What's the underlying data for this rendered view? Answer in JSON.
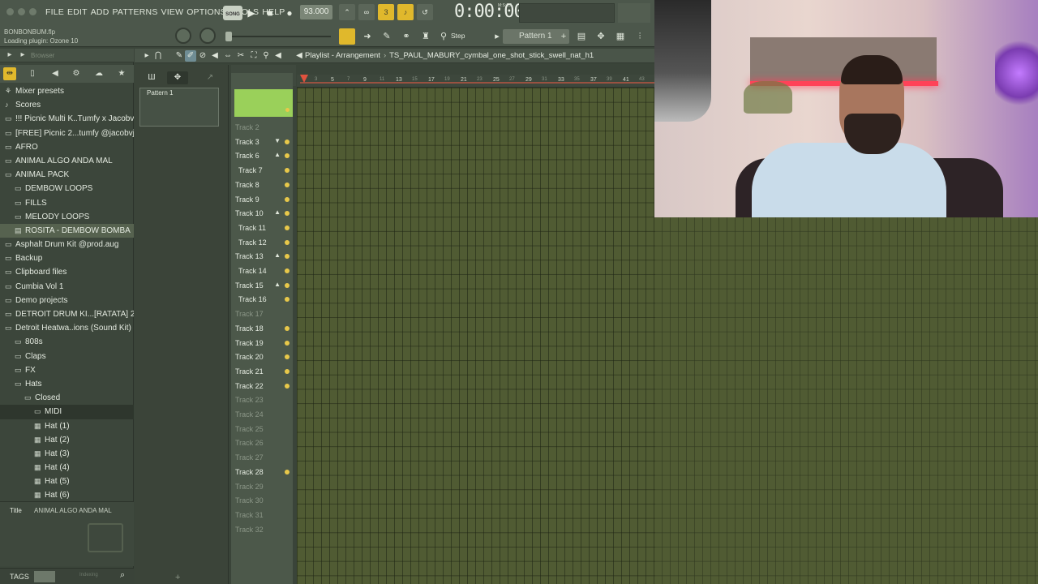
{
  "menu": [
    "FILE",
    "EDIT",
    "ADD",
    "PATTERNS",
    "VIEW",
    "OPTIONS",
    "TOOLS",
    "HELP"
  ],
  "transport": {
    "song_mode": "SONG",
    "tempo": "93.000",
    "time": "0:00:00",
    "time_unit": "M:S:CS"
  },
  "project": {
    "filename": "BONBONBUM.flp",
    "hint": "Loading plugin: Ozone 10"
  },
  "toolbar2": {
    "step_label": "Step",
    "pattern": "Pattern 1"
  },
  "browser": {
    "title": "Browser",
    "items": [
      {
        "label": "Mixer presets",
        "icon": "mixer-icon",
        "indent": 0
      },
      {
        "label": "Scores",
        "icon": "note-icon",
        "indent": 0
      },
      {
        "label": "!!! Picnic Multi K..Tumfy x Jacobvj))",
        "icon": "folder-icon",
        "indent": 0
      },
      {
        "label": "[FREE] Picnic 2...tumfy @jacobvj1)",
        "icon": "folder-icon",
        "indent": 0
      },
      {
        "label": "AFRO",
        "icon": "folder-icon",
        "indent": 0
      },
      {
        "label": "ANIMAL ALGO ANDA MAL",
        "icon": "folder-icon",
        "indent": 0
      },
      {
        "label": "ANIMAL PACK",
        "icon": "folder-icon",
        "indent": 0
      },
      {
        "label": "DEMBOW LOOPS",
        "icon": "folder-icon",
        "indent": 1
      },
      {
        "label": "FILLS",
        "icon": "folder-icon",
        "indent": 1
      },
      {
        "label": "MELODY LOOPS",
        "icon": "folder-icon",
        "indent": 1
      },
      {
        "label": "ROSITA - DEMBOW BOMBA",
        "icon": "file-icon",
        "indent": 1,
        "highlight": true
      },
      {
        "label": "Asphalt Drum Kit @prod.aug",
        "icon": "folder-icon",
        "indent": 0
      },
      {
        "label": "Backup",
        "icon": "backup-icon",
        "indent": 0
      },
      {
        "label": "Clipboard files",
        "icon": "folder-icon",
        "indent": 0
      },
      {
        "label": "Cumbia Vol 1",
        "icon": "folder-icon",
        "indent": 0
      },
      {
        "label": "Demo projects",
        "icon": "folder-icon",
        "indent": 0
      },
      {
        "label": "DETROIT DRUM KI...[RATATA] 2023",
        "icon": "folder-icon",
        "indent": 0
      },
      {
        "label": "Detroit Heatwa..ions (Sound Kit)",
        "icon": "folder-icon",
        "indent": 0
      },
      {
        "label": "808s",
        "icon": "folder-icon",
        "indent": 1
      },
      {
        "label": "Claps",
        "icon": "folder-icon",
        "indent": 1
      },
      {
        "label": "FX",
        "icon": "folder-icon",
        "indent": 1
      },
      {
        "label": "Hats",
        "icon": "folder-icon",
        "indent": 1
      },
      {
        "label": "Closed",
        "icon": "folder-icon",
        "indent": 2
      },
      {
        "label": "MIDI",
        "icon": "folder-icon",
        "indent": 3,
        "selected": true
      },
      {
        "label": "Hat (1)",
        "icon": "midi-file-icon",
        "indent": 3
      },
      {
        "label": "Hat (2)",
        "icon": "midi-file-icon",
        "indent": 3
      },
      {
        "label": "Hat (3)",
        "icon": "midi-file-icon",
        "indent": 3
      },
      {
        "label": "Hat (4)",
        "icon": "midi-file-icon",
        "indent": 3
      },
      {
        "label": "Hat (5)",
        "icon": "midi-file-icon",
        "indent": 3
      },
      {
        "label": "Hat (6)",
        "icon": "midi-file-icon",
        "indent": 3
      }
    ],
    "meta_title_label": "Title",
    "meta_title_value": "ANIMAL ALGO ANDA MAL",
    "tags_label": "TAGS",
    "indexing": "Indexing"
  },
  "picker": {
    "pattern_clip": "Pattern 1"
  },
  "playlist": {
    "title": "Playlist - Arrangement",
    "sample": "TS_PAUL_MABURY_cymbal_one_shot_stick_swell_nat_h1",
    "ruler": [
      "3",
      "5",
      "7",
      "9",
      "11",
      "13",
      "15",
      "17",
      "19",
      "21",
      "23",
      "25",
      "27",
      "29",
      "31",
      "33",
      "35",
      "37",
      "39",
      "41",
      "43"
    ],
    "tracks": [
      {
        "name": "Track 2",
        "muted": true
      },
      {
        "name": "Track 3",
        "arrow": "▼"
      },
      {
        "name": "Track 6",
        "arrow": "▲"
      },
      {
        "name": "Track 7",
        "indent": true
      },
      {
        "name": "Track 8"
      },
      {
        "name": "Track 9"
      },
      {
        "name": "Track 10",
        "arrow": "▲"
      },
      {
        "name": "Track 11",
        "indent": true
      },
      {
        "name": "Track 12",
        "indent": true
      },
      {
        "name": "Track 13",
        "arrow": "▲"
      },
      {
        "name": "Track 14",
        "indent": true
      },
      {
        "name": "Track 15",
        "arrow": "▲"
      },
      {
        "name": "Track 16",
        "indent": true
      },
      {
        "name": "Track 17",
        "muted": true
      },
      {
        "name": "Track 18"
      },
      {
        "name": "Track 19"
      },
      {
        "name": "Track 20"
      },
      {
        "name": "Track 21"
      },
      {
        "name": "Track 22"
      },
      {
        "name": "Track 23",
        "muted": true
      },
      {
        "name": "Track 24",
        "muted": true
      },
      {
        "name": "Track 25",
        "muted": true
      },
      {
        "name": "Track 26",
        "muted": true
      },
      {
        "name": "Track 27",
        "muted": true
      },
      {
        "name": "Track 28"
      },
      {
        "name": "Track 29",
        "muted": true
      },
      {
        "name": "Track 30",
        "muted": true
      },
      {
        "name": "Track 31",
        "muted": true
      },
      {
        "name": "Track 32",
        "muted": true
      }
    ]
  },
  "colors": {
    "accent": "#e0b82c",
    "clip_green": "#9ad05a",
    "grid_bg": "#505b33",
    "track_dot": "#e8c84a"
  }
}
